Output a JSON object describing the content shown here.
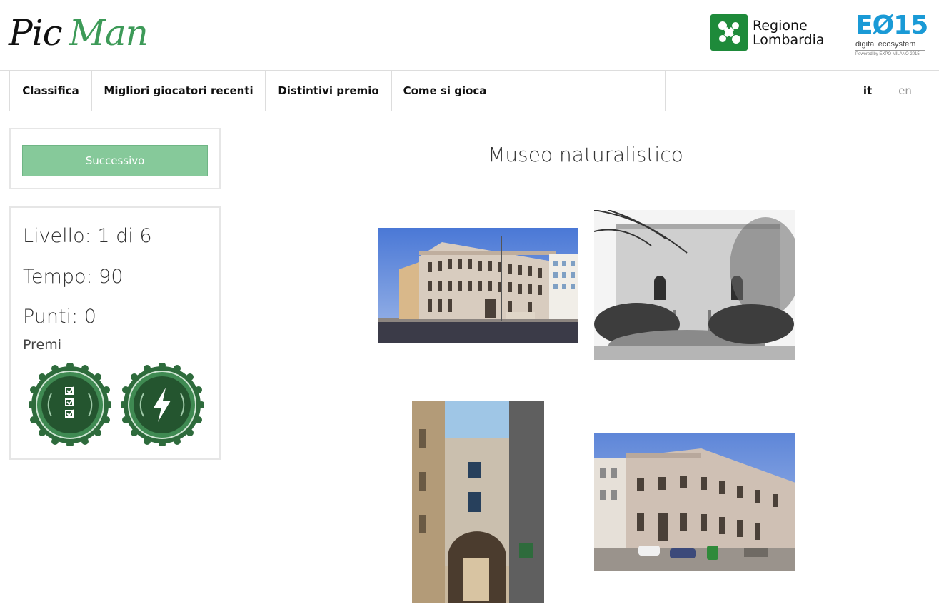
{
  "brand": {
    "logo_part1": "Pic",
    "logo_part2": "Man"
  },
  "partners": {
    "regione_line1": "Regione",
    "regione_line2": "Lombardia",
    "e015_title": "EØ15",
    "e015_subtitle": "digital ecosystem",
    "e015_powered": "Powered by EXPO MILANO 2015"
  },
  "nav": {
    "items": [
      "Classifica",
      "Migliori giocatori recenti",
      "Distintivi premio",
      "Come si gioca"
    ],
    "lang_it": "it",
    "lang_en": "en"
  },
  "sidebar": {
    "next_button": "Successivo",
    "level": "Livello: 1 di 6",
    "time": "Tempo: 90",
    "points": "Punti: 0",
    "awards_label": "Premi",
    "badges": [
      "checklist-badge-icon",
      "lightning-badge-icon"
    ]
  },
  "main": {
    "question_title": "Museo naturalistico",
    "photos": [
      "palazzo-photo",
      "garden-villa-photo",
      "arch-street-photo",
      "corner-building-photo"
    ]
  },
  "colors": {
    "accent_green": "#3d9a58",
    "button_green": "#86c99a",
    "badge_green": "#2e6b3c",
    "e015_blue": "#1a9ad6"
  }
}
